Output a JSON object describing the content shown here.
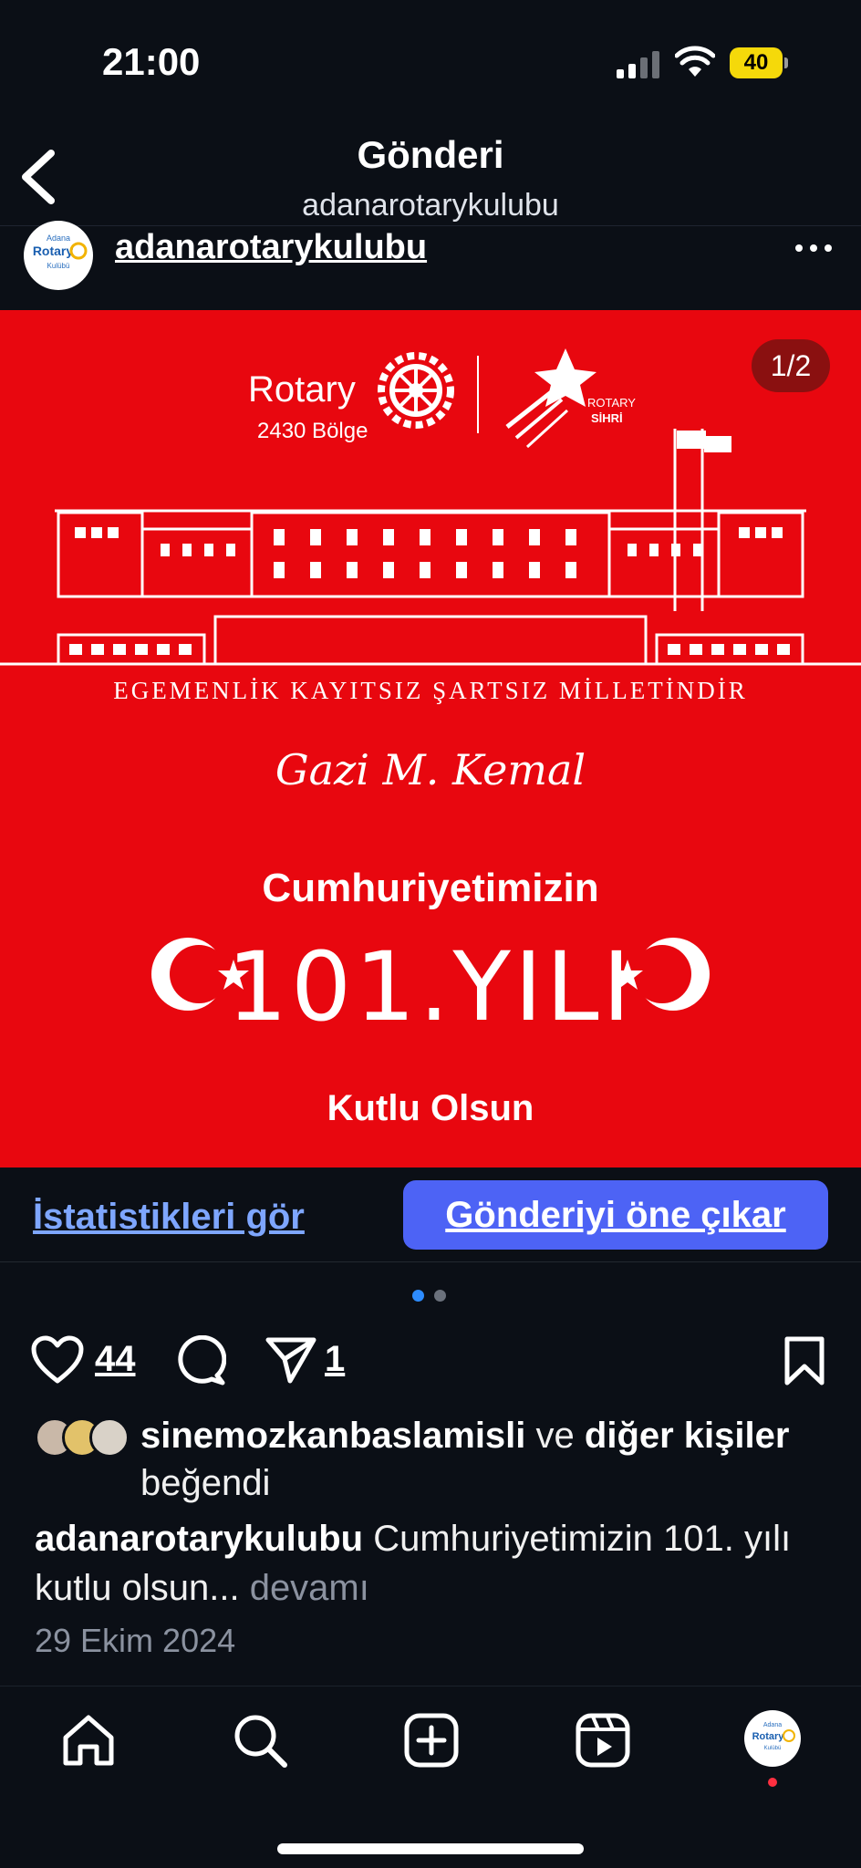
{
  "status_bar": {
    "time": "21:00",
    "battery": "40"
  },
  "header": {
    "title": "Gönderi",
    "subtitle": "adanarotarykulubu"
  },
  "post": {
    "author": "adanarotarykulubu",
    "avatar_text": {
      "line1": "Adana",
      "line2": "Rotary",
      "line3": "Kulübü"
    },
    "image_counter": "1/2",
    "image": {
      "brand": "Rotary",
      "district": "2430 Bölge",
      "partner_top": "ROTARY",
      "partner_bottom": "SİHRİ",
      "motto": "EGEMENLİK KAYITSIZ ŞARTSIZ MİLLETİNDİR",
      "signature": "Gazi M. Kemal",
      "line1": "Cumhuriyetimizin",
      "line2": "101.YILI",
      "line3": "Kutlu Olsun",
      "background_color": "#e8070f"
    }
  },
  "actions": {
    "stats_label": "İstatistikleri gör",
    "promote_label": "Gönderiyi öne çıkar",
    "like_count": "44",
    "share_count": "1"
  },
  "likes": {
    "user": "sinemozkanbaslamisli",
    "connector": " ve ",
    "others": "diğer kişiler",
    "suffix": " beğendi"
  },
  "caption": {
    "author": "adanarotarykulubu",
    "text": " Cumhuriyetimizin 101. yılı kutlu olsun...",
    "more": " devamı"
  },
  "date": "29 Ekim 2024",
  "nav": {
    "items": [
      "home-icon",
      "search-icon",
      "create-icon",
      "reels-icon",
      "profile-avatar"
    ]
  },
  "colors": {
    "accent": "#4d63f5",
    "link": "#7ea6ff",
    "background": "#0b0f16"
  }
}
